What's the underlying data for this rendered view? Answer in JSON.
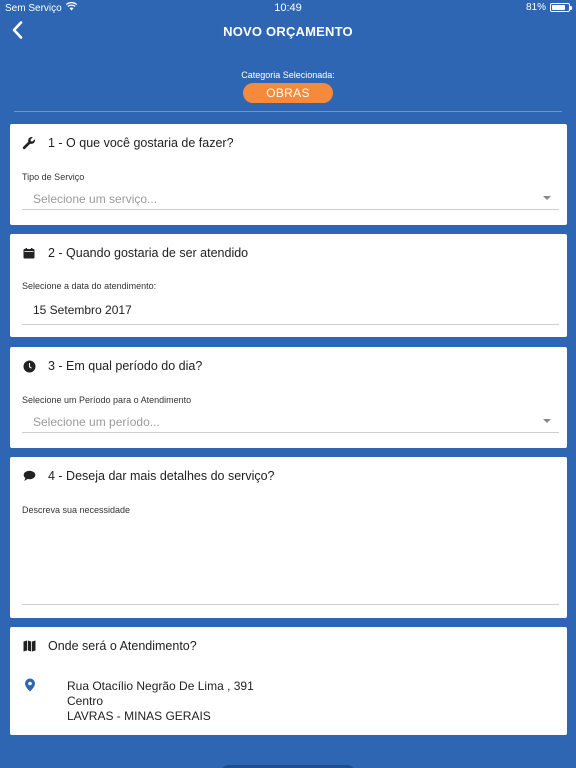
{
  "status_bar": {
    "carrier": "Sem Serviço",
    "time": "10:49",
    "battery": "81%",
    "battery_level": 0.81
  },
  "nav": {
    "title": "NOVO ORÇAMENTO",
    "back_icon": "chevron-left-icon"
  },
  "category": {
    "label": "Categoria Selecionada:",
    "value": "OBRAS",
    "badge_color": "#f58a3c"
  },
  "cards": {
    "service": {
      "title": "1 - O que você gostaria de fazer?",
      "icon": "wrench-icon",
      "field_label": "Tipo de Serviço",
      "placeholder": "Selecione um serviço..."
    },
    "date": {
      "title": "2 - Quando gostaria de ser atendido",
      "icon": "calendar-icon",
      "field_label": "Selecione a data do atendimento:",
      "value": "15 Setembro 2017"
    },
    "period": {
      "title": "3 - Em qual período do dia?",
      "icon": "clock-icon",
      "field_label": "Selecione um Período para o Atendimento",
      "placeholder": "Selecione um período..."
    },
    "details": {
      "title": "4 - Deseja dar mais detalhes do serviço?",
      "icon": "chat-icon",
      "field_label": "Descreva sua necessidade"
    },
    "location": {
      "title": "Onde será o Atendimento?",
      "icon": "map-icon",
      "pin_icon": "location-pin-icon",
      "address_line1": "Rua Otacílio Negrão De Lima , 391",
      "address_line2": "Centro",
      "address_line3": "LAVRAS - MINAS GERAIS"
    }
  },
  "colors": {
    "background": "#2f66b3",
    "accent": "#f58a3c",
    "pin": "#2f66b3"
  }
}
